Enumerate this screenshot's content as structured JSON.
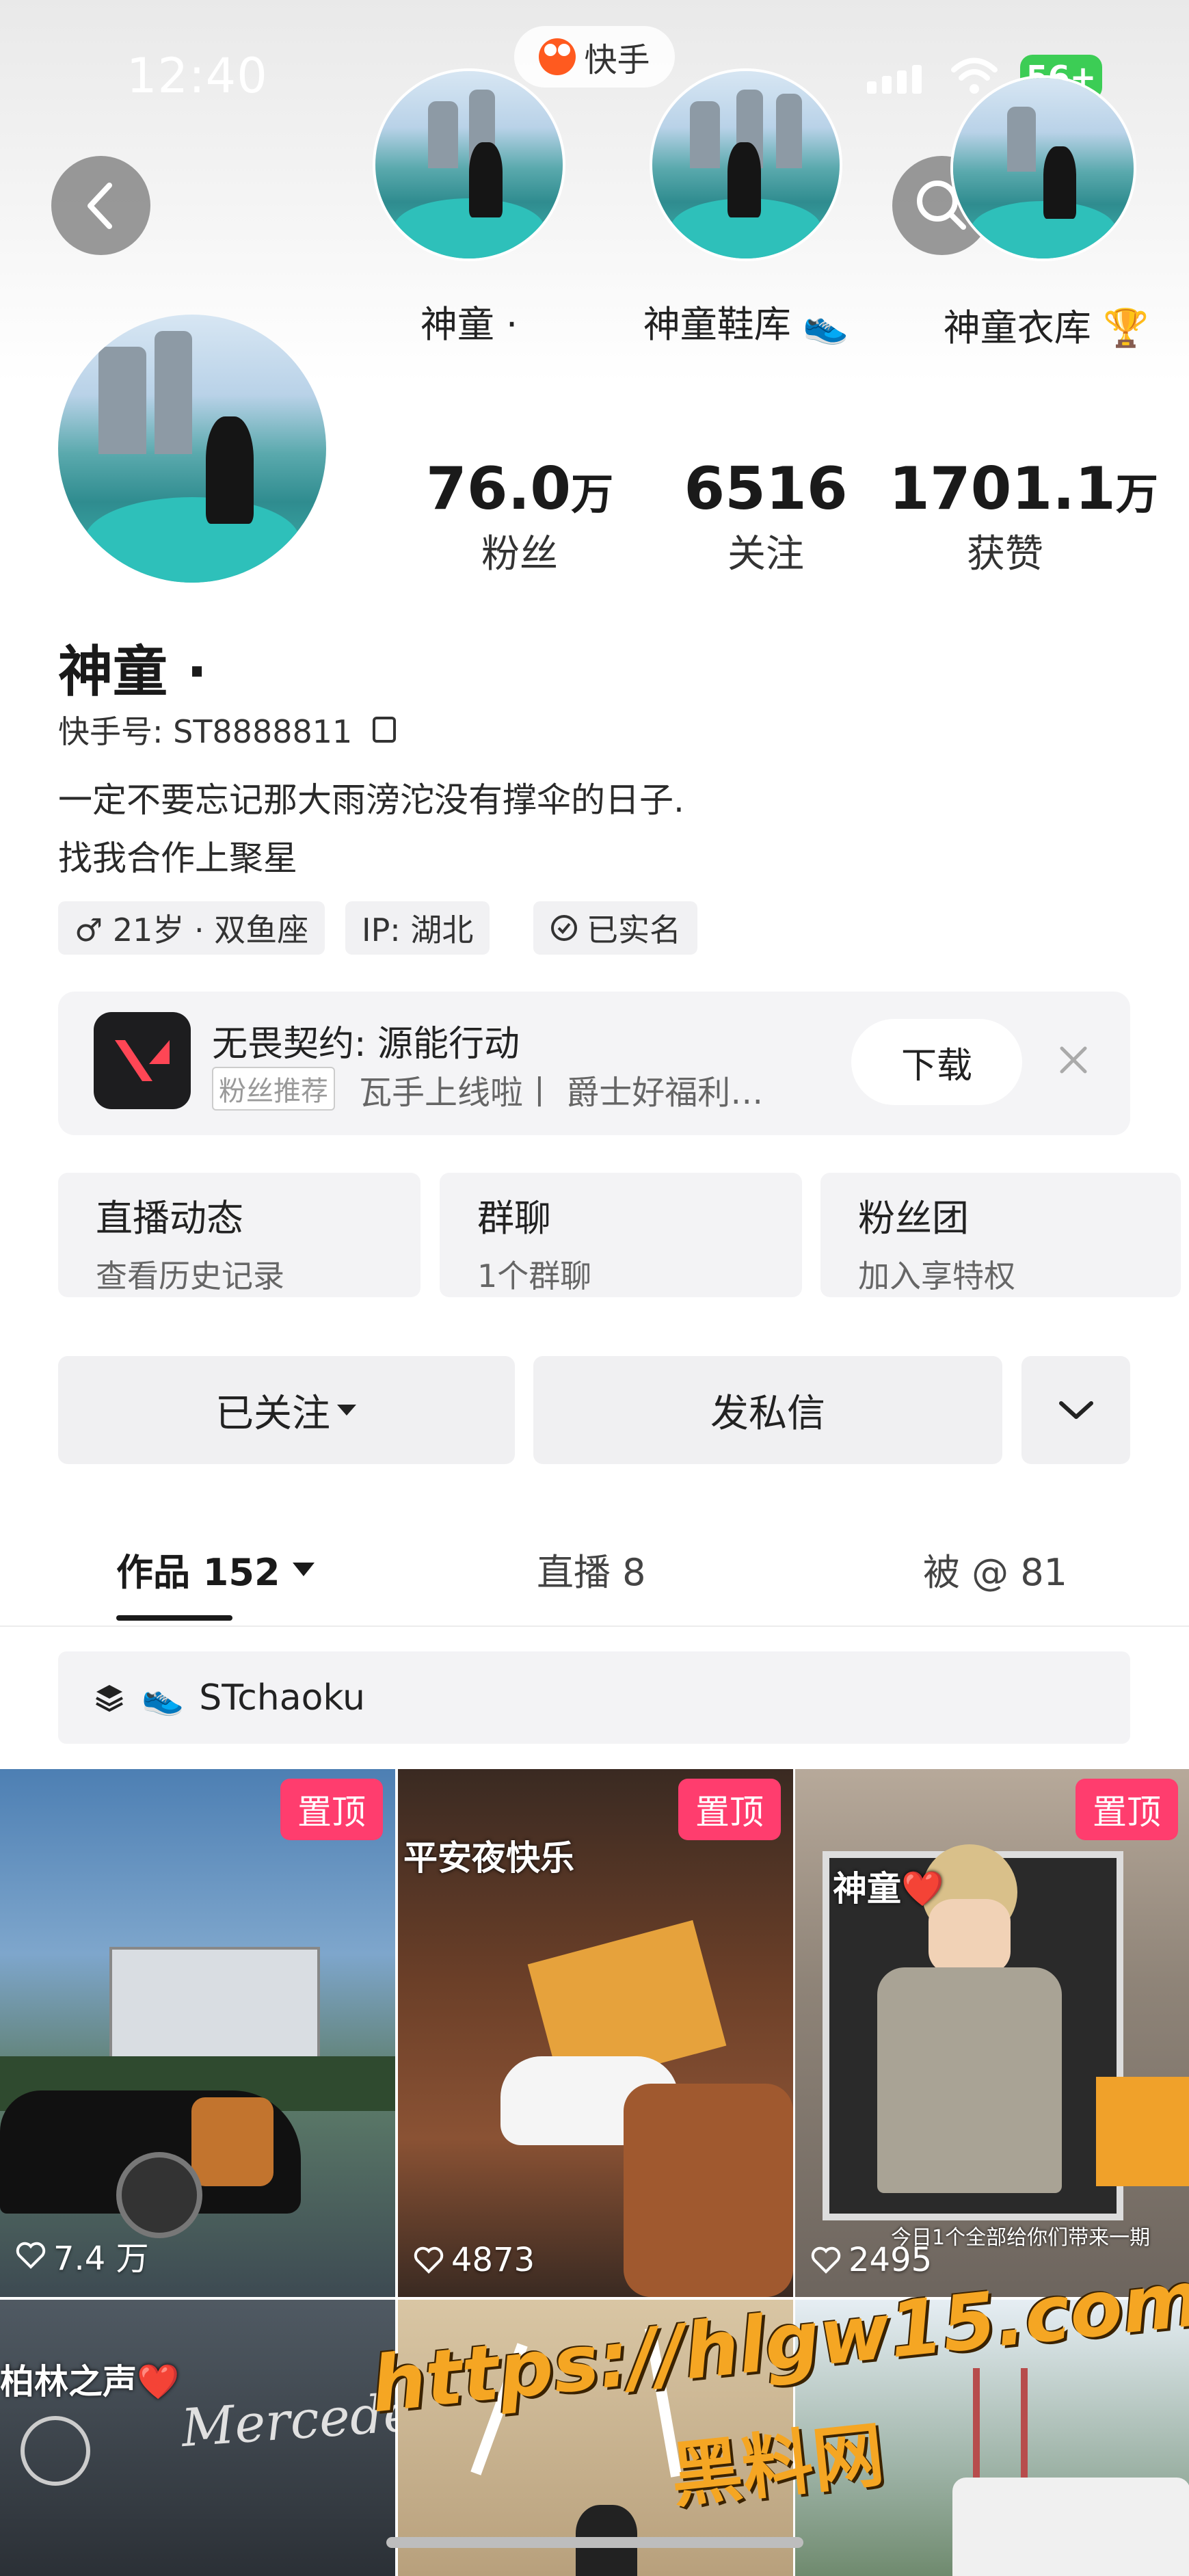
{
  "status_bar": {
    "time": "12:40",
    "battery": "56+"
  },
  "app": {
    "name": "快手"
  },
  "stories": [
    {
      "label": "神童 ·"
    },
    {
      "label": "神童鞋库 👟"
    },
    {
      "label": "神童衣库 🏆"
    }
  ],
  "profile": {
    "name": "神童 ·",
    "kuaishou_id": "快手号: ST8888811",
    "bio_line1": "一定不要忘记那大雨滂沱没有撑伞的日子.",
    "bio_line2": "找我合作上聚星",
    "stats": [
      {
        "value": "76.0",
        "unit": "万",
        "label": "粉丝"
      },
      {
        "value": "6516",
        "unit": "",
        "label": "关注"
      },
      {
        "value": "1701.1",
        "unit": "万",
        "label": "获赞"
      }
    ],
    "tags": [
      "♂ 21岁 · 双鱼座",
      "IP: 湖北",
      "已实名"
    ]
  },
  "ad": {
    "title": "无畏契约: 源能行动",
    "badge": "粉丝推荐",
    "desc": "瓦手上线啦丨 爵士好福利…",
    "button": "下载"
  },
  "cards": [
    {
      "title": "直播动态",
      "sub": "查看历史记录"
    },
    {
      "title": "群聊",
      "sub": "1个群聊"
    },
    {
      "title": "粉丝团",
      "sub": "加入享特权"
    }
  ],
  "actions": {
    "follow": "已关注",
    "message": "发私信"
  },
  "tabs": [
    {
      "label": "作品 152"
    },
    {
      "label": "直播 8"
    },
    {
      "label": "被 @ 81"
    }
  ],
  "collection": {
    "label": "STchaoku"
  },
  "videos": [
    {
      "pinned_label": "置顶",
      "likes": "7.4 万",
      "caption": ""
    },
    {
      "pinned_label": "置顶",
      "likes": "4873",
      "caption": "平安夜快乐"
    },
    {
      "pinned_label": "置顶",
      "likes": "2495",
      "caption": "神童❤️"
    },
    {
      "pinned_label": "",
      "likes": "",
      "caption": "柏林之声❤️"
    },
    {
      "pinned_label": "",
      "likes": "",
      "caption": ""
    },
    {
      "pinned_label": "",
      "likes": "",
      "caption": ""
    }
  ],
  "tile_extra": {
    "video3_subtitle": "今日1个全部给你们带来一期",
    "video4_sign": "Mercedes"
  },
  "watermark": {
    "url": "https://hlgw15.com",
    "site": "黑料网"
  },
  "colors": {
    "pin": "#ff3d6e",
    "kuaishou_orange": "#ff5a1f",
    "battery_green": "#3ccd55"
  }
}
